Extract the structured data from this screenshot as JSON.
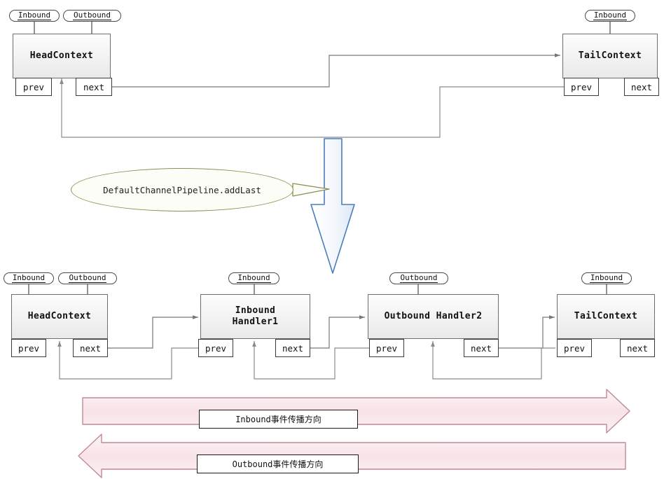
{
  "diagram": {
    "title": "Netty ChannelPipeline handler linked-list diagram",
    "colors": {
      "node_border": "#6e6e6e",
      "slot_border": "#3a3a3a",
      "connector": "#777777",
      "callout_border": "#8d8d55",
      "callout_fill": "#fdfdf7",
      "big_arrow_border": "#4a7ebb",
      "big_arrow_fill": "#eef3fa",
      "flow_arrow_border": "#c08a95",
      "flow_arrow_fill": "#fbeef0",
      "node_fill": "#f2f2f2"
    },
    "slot_labels": {
      "prev": "prev",
      "next": "next"
    },
    "tags": {
      "inbound": "Inbound",
      "outbound": "Outbound"
    },
    "top_section": {
      "nodes": [
        {
          "id": "head",
          "label": "HeadContext",
          "tags": [
            "Inbound",
            "Outbound"
          ]
        },
        {
          "id": "tail",
          "label": "TailContext",
          "tags": [
            "Inbound"
          ]
        }
      ]
    },
    "callout": {
      "text": "DefaultChannelPipeline.addLast"
    },
    "bottom_section": {
      "nodes": [
        {
          "id": "head2",
          "label": "HeadContext",
          "tags": [
            "Inbound",
            "Outbound"
          ]
        },
        {
          "id": "inbound1",
          "label": "Inbound\nHandler1",
          "tags": [
            "Inbound"
          ]
        },
        {
          "id": "outbound2",
          "label": "Outbound Handler2",
          "tags": [
            "Outbound"
          ]
        },
        {
          "id": "tail2",
          "label": "TailContext",
          "tags": [
            "Inbound"
          ]
        }
      ]
    },
    "flow": {
      "inbound_direction_label": "Inbound事件传播方向",
      "outbound_direction_label": "Outbound事件传播方向"
    }
  }
}
